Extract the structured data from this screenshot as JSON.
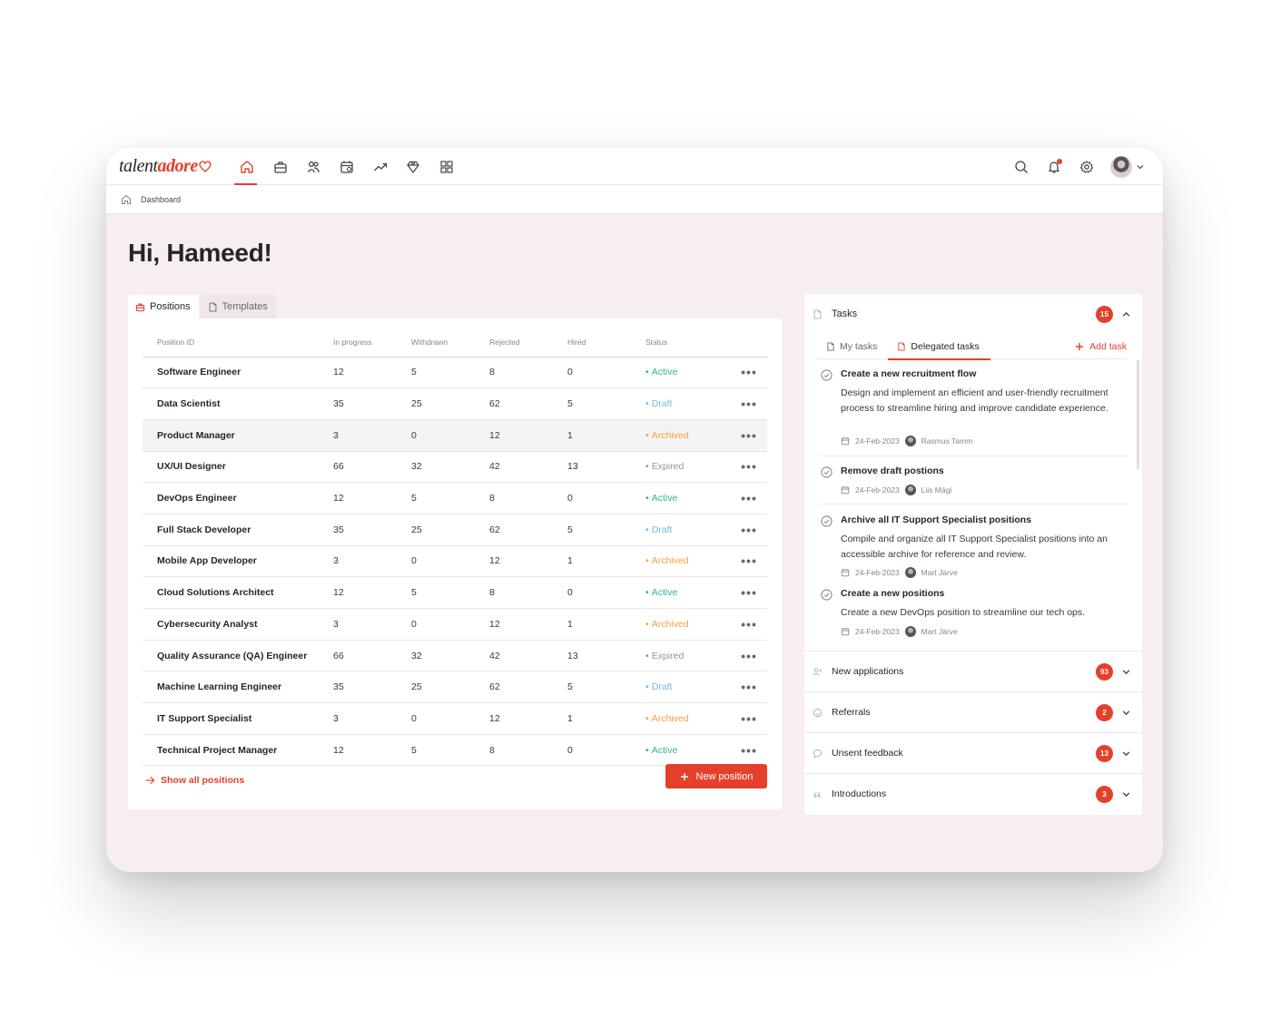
{
  "brand": {
    "logo_part1": "talent",
    "logo_part2": "adore",
    "accent": "#e4402b"
  },
  "nav": {
    "icons": [
      "home-icon",
      "briefcase-icon",
      "candidates-icon",
      "calendar-icon",
      "trending-icon",
      "diamond-icon",
      "grid-icon"
    ],
    "active": "home-icon"
  },
  "breadcrumb": {
    "label": "Dashboard"
  },
  "greeting": "Hi, Hameed!",
  "positions": {
    "tabs": [
      {
        "label": "Positions"
      },
      {
        "label": "Templates"
      }
    ],
    "columns": [
      "Position ID",
      "In progress",
      "Withdrawn",
      "Rejected",
      "Hired",
      "Status"
    ],
    "rows": [
      {
        "name": "Software Engineer",
        "in_progress": "12",
        "withdrawn": "5",
        "rejected": "8",
        "hired": "0",
        "status": "Active"
      },
      {
        "name": "Data Scientist",
        "in_progress": "35",
        "withdrawn": "25",
        "rejected": "62",
        "hired": "5",
        "status": "Draft"
      },
      {
        "name": "Product Manager",
        "in_progress": "3",
        "withdrawn": "0",
        "rejected": "12",
        "hired": "1",
        "status": "Archived"
      },
      {
        "name": "UX/UI Designer",
        "in_progress": "66",
        "withdrawn": "32",
        "rejected": "42",
        "hired": "13",
        "status": "Expired"
      },
      {
        "name": "DevOps Engineer",
        "in_progress": "12",
        "withdrawn": "5",
        "rejected": "8",
        "hired": "0",
        "status": "Active"
      },
      {
        "name": "Full Stack Developer",
        "in_progress": "35",
        "withdrawn": "25",
        "rejected": "62",
        "hired": "5",
        "status": "Draft"
      },
      {
        "name": "Mobile App Developer",
        "in_progress": "3",
        "withdrawn": "0",
        "rejected": "12",
        "hired": "1",
        "status": "Archived"
      },
      {
        "name": "Cloud Solutions Architect",
        "in_progress": "12",
        "withdrawn": "5",
        "rejected": "8",
        "hired": "0",
        "status": "Active"
      },
      {
        "name": "Cybersecurity Analyst",
        "in_progress": "3",
        "withdrawn": "0",
        "rejected": "12",
        "hired": "1",
        "status": "Archived"
      },
      {
        "name": "Quality Assurance (QA) Engineer",
        "in_progress": "66",
        "withdrawn": "32",
        "rejected": "42",
        "hired": "13",
        "status": "Expired"
      },
      {
        "name": "Machine Learning Engineer",
        "in_progress": "35",
        "withdrawn": "25",
        "rejected": "62",
        "hired": "5",
        "status": "Draft"
      },
      {
        "name": "IT Support Specialist",
        "in_progress": "3",
        "withdrawn": "0",
        "rejected": "12",
        "hired": "1",
        "status": "Archived"
      },
      {
        "name": "Technical Project Manager",
        "in_progress": "12",
        "withdrawn": "5",
        "rejected": "8",
        "hired": "0",
        "status": "Active"
      }
    ],
    "row_menu_glyph": "•••",
    "show_all_label": "Show all positions",
    "new_position_label": "New position",
    "status_colors": {
      "Active": "#2bb39a",
      "Draft": "#76b7e5",
      "Archived": "#f0a23a",
      "Expired": "#9c9496"
    }
  },
  "tasks": {
    "title": "Tasks",
    "count": "15",
    "tabs": [
      {
        "label": "My tasks"
      },
      {
        "label": "Delegated tasks"
      }
    ],
    "add_task_label": "Add task",
    "items": [
      {
        "title": "Create a new recruitment flow",
        "description": "Design and implement an efficient and user-friendly recruitment process to streamline hiring and improve candidate experience.",
        "date": "24-Feb-2023",
        "assignee": "Rasmus Tamm"
      },
      {
        "title": "Remove draft postions",
        "description": "",
        "date": "24-Feb-2023",
        "assignee": "Liis Mägi"
      },
      {
        "title": "Archive all IT Support Specialist positions",
        "description": "Compile and organize all IT Support Specialist positions into an accessible archive for reference and review.",
        "date": "24-Feb-2023",
        "assignee": "Mart Järve"
      },
      {
        "title": "Create a new positions",
        "description": "Create a new DevOps position to streamline our tech ops.",
        "date": "24-Feb-2023",
        "assignee": "Mart Järve"
      }
    ]
  },
  "sections": [
    {
      "label": "New applications",
      "count": "93",
      "icon": "user-plus-icon"
    },
    {
      "label": "Referrals",
      "count": "2",
      "icon": "smile-icon"
    },
    {
      "label": "Unsent feedback",
      "count": "13",
      "icon": "chat-icon"
    },
    {
      "label": "Introductions",
      "count": "3",
      "icon": "quote-icon"
    }
  ]
}
